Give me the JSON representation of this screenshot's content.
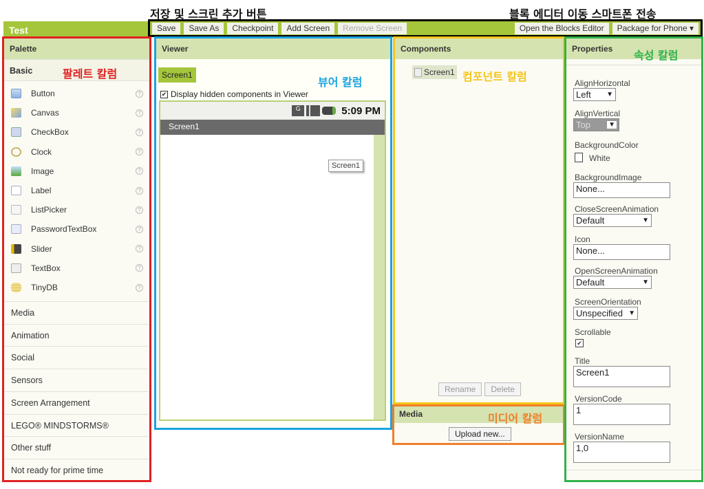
{
  "annotations": {
    "save_add": "저장 및 스크린 추가 버튼",
    "blocks_phone": "블록 에디터 이동  스마트폰 전송",
    "palette": "팔레트 칼럼",
    "viewer": "뷰어 칼럼",
    "components": "컴포넌트 칼럼",
    "properties": "속성 칼럼",
    "media": "미디어 칼럼"
  },
  "colors": {
    "brand_green": "#a5c63b",
    "header_green": "#d5e3b0",
    "palette_box": "#e02020",
    "viewer_box": "#1aa3e0",
    "components_box": "#f5c518",
    "media_box": "#f07f2a",
    "properties_box": "#2fb24a"
  },
  "project": {
    "title": "Test"
  },
  "toolbar": {
    "save": "Save",
    "save_as": "Save As",
    "checkpoint": "Checkpoint",
    "add_screen": "Add Screen",
    "remove_screen": "Remove Screen",
    "blocks_editor": "Open the Blocks Editor",
    "package": "Package for Phone ▾"
  },
  "palette": {
    "title": "Palette",
    "basic": "Basic",
    "items": [
      {
        "label": "Button",
        "icon": "button-icon"
      },
      {
        "label": "Canvas",
        "icon": "canvas-icon"
      },
      {
        "label": "CheckBox",
        "icon": "checkbox-icon"
      },
      {
        "label": "Clock",
        "icon": "clock-icon"
      },
      {
        "label": "Image",
        "icon": "image-icon"
      },
      {
        "label": "Label",
        "icon": "label-icon"
      },
      {
        "label": "ListPicker",
        "icon": "listpicker-icon"
      },
      {
        "label": "PasswordTextBox",
        "icon": "password-icon"
      },
      {
        "label": "Slider",
        "icon": "slider-icon"
      },
      {
        "label": "TextBox",
        "icon": "textbox-icon"
      },
      {
        "label": "TinyDB",
        "icon": "database-icon"
      }
    ],
    "help": "?",
    "categories": [
      "Media",
      "Animation",
      "Social",
      "Sensors",
      "Screen Arrangement",
      "LEGO® MINDSTORMS®",
      "Other stuff",
      "Not ready for prime time"
    ]
  },
  "viewer": {
    "title": "Viewer",
    "screen_tab": "Screen1",
    "hidden_label": "Display hidden components in Viewer",
    "hidden_checked": true,
    "time": "5:09 PM",
    "screen_title": "Screen1",
    "tooltip": "Screen1"
  },
  "components": {
    "title": "Components",
    "tree_item": "Screen1",
    "rename": "Rename",
    "delete": "Delete"
  },
  "media": {
    "title": "Media",
    "upload": "Upload new..."
  },
  "properties": {
    "title": "Properties",
    "align_h_label": "AlignHorizontal",
    "align_h": "Left",
    "align_v_label": "AlignVertical",
    "align_v": "Top",
    "bgcolor_label": "BackgroundColor",
    "bgcolor": "White",
    "bgimage_label": "BackgroundImage",
    "bgimage": "None...",
    "close_anim_label": "CloseScreenAnimation",
    "close_anim": "Default",
    "icon_label": "Icon",
    "icon": "None...",
    "open_anim_label": "OpenScreenAnimation",
    "open_anim": "Default",
    "orientation_label": "ScreenOrientation",
    "orientation": "Unspecified",
    "scrollable_label": "Scrollable",
    "scrollable": true,
    "title_label": "Title",
    "title_value": "Screen1",
    "version_code_label": "VersionCode",
    "version_code": "1",
    "version_name_label": "VersionName",
    "version_name": "1,0"
  }
}
